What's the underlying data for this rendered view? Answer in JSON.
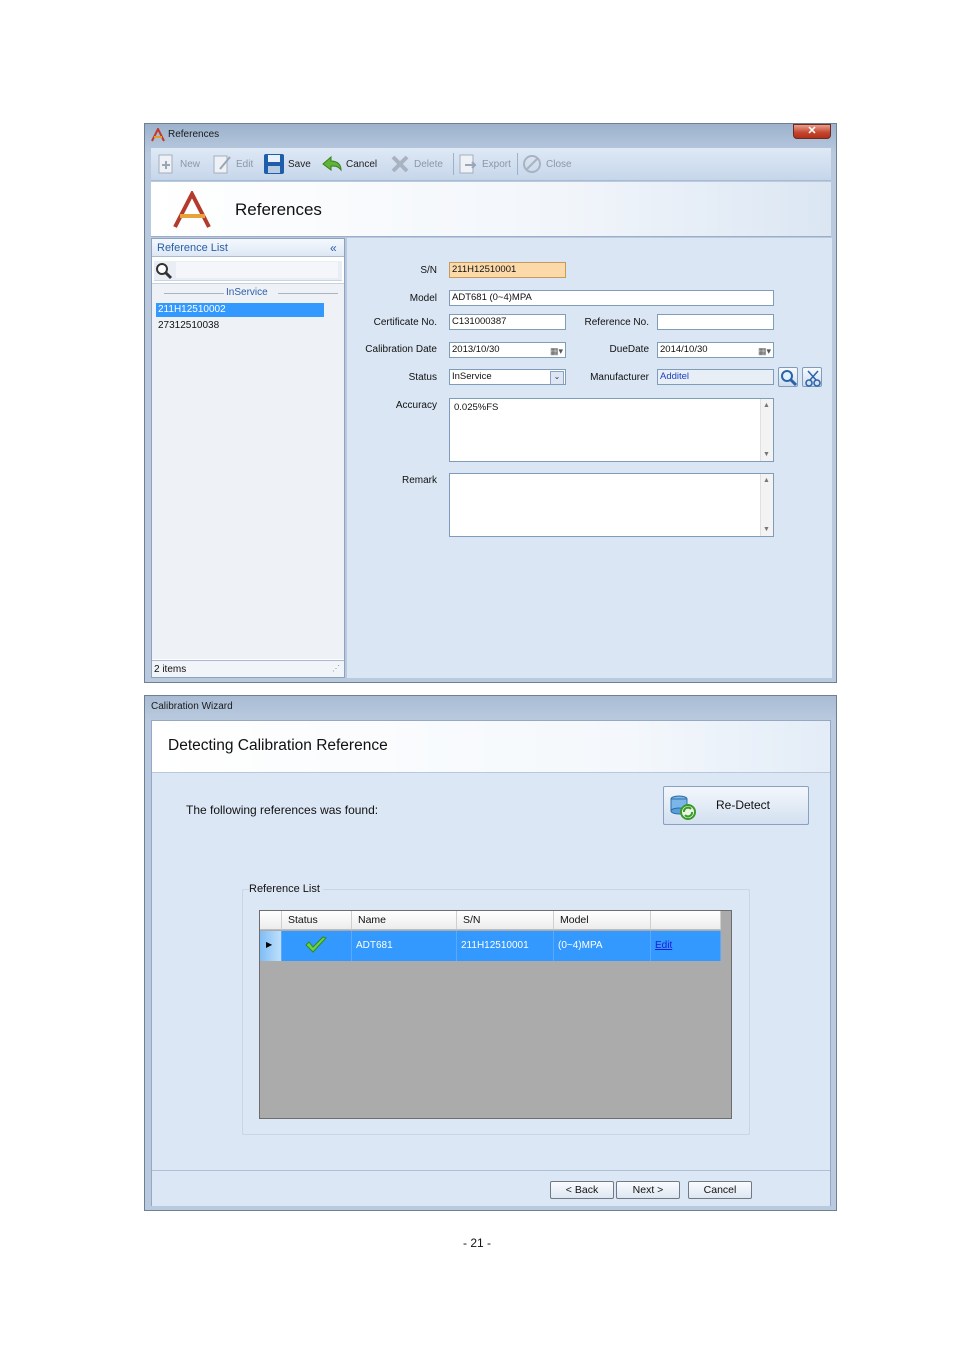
{
  "references_window": {
    "title": "References",
    "close_label": "✕",
    "toolbar": {
      "new": "New",
      "edit": "Edit",
      "save": "Save",
      "cancel": "Cancel",
      "delete": "Delete",
      "export": "Export",
      "close": "Close"
    },
    "header_title": "References",
    "reference_list": {
      "title": "Reference List",
      "collapse": "«",
      "group": "InService",
      "items": [
        "211H12510002",
        "27312510038"
      ],
      "selected_index": 0,
      "footer": "2 items"
    },
    "form": {
      "sn_label": "S/N",
      "sn_value": "211H12510001",
      "model_label": "Model",
      "model_value": "ADT681 (0~4)MPA",
      "cert_label": "Certificate No.",
      "cert_value": "C131000387",
      "refno_label": "Reference No.",
      "refno_value": "",
      "caldate_label": "Calibration Date",
      "caldate_value": "2013/10/30",
      "duedate_label": "DueDate",
      "duedate_value": "2014/10/30",
      "status_label": "Status",
      "status_value": "InService",
      "manufacturer_label": "Manufacturer",
      "manufacturer_value": "Additel",
      "accuracy_label": "Accuracy",
      "accuracy_value": "0.025%FS",
      "remark_label": "Remark",
      "remark_value": ""
    }
  },
  "wizard_window": {
    "title": "Calibration Wizard",
    "heading": "Detecting Calibration Reference",
    "found_text": "The following references was found:",
    "redetect_label": "Re-Detect",
    "reference_list_label": "Reference List",
    "columns": [
      "Status",
      "Name",
      "S/N",
      "Model"
    ],
    "rows": [
      {
        "status": "ok",
        "name": "ADT681",
        "sn": "211H12510001",
        "model": "(0~4)MPA",
        "action": "Edit"
      }
    ],
    "back_label": "< Back",
    "next_label": "Next >",
    "cancel_label": "Cancel"
  },
  "page_number": "- 21 -",
  "colors": {
    "selection": "#3399ff",
    "sn_highlight": "#fbd9a9",
    "check_green": "#3fa535"
  }
}
